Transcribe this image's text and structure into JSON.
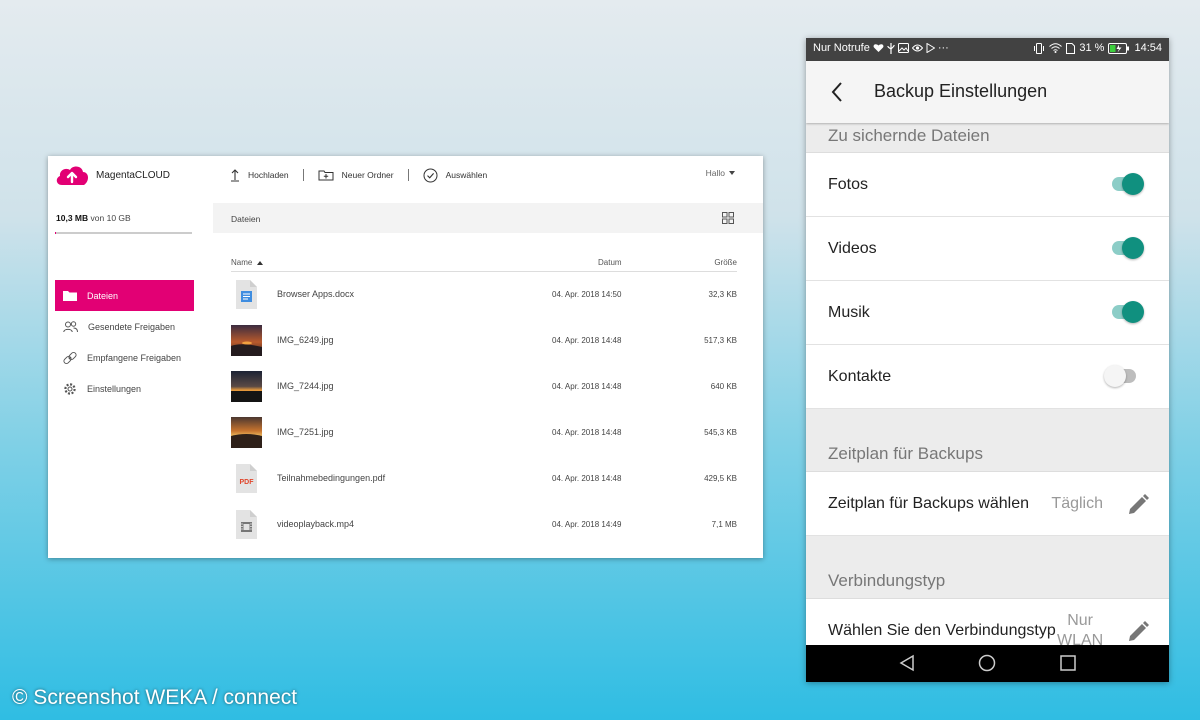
{
  "web": {
    "brand": {
      "prefix": "Magenta",
      "suffix": "CLOUD"
    },
    "toolbar": {
      "upload": "Hochladen",
      "new_folder": "Neuer Ordner",
      "select": "Auswählen"
    },
    "greeting": "Hallo",
    "storage": {
      "used": "10,3 MB",
      "of": "von",
      "total": "10 GB",
      "used_fraction": 0.001
    },
    "breadcrumb": "Dateien",
    "sidebar": [
      {
        "label": "Dateien",
        "icon": "folder-icon",
        "active": true
      },
      {
        "label": "Gesendete Freigaben",
        "icon": "people-icon",
        "active": false
      },
      {
        "label": "Empfangene Freigaben",
        "icon": "link-icon",
        "active": false
      },
      {
        "label": "Einstellungen",
        "icon": "gear-icon",
        "active": false
      }
    ],
    "columns": {
      "name": "Name",
      "date": "Datum",
      "size": "Größe"
    },
    "files": [
      {
        "name": "Browser Apps.docx",
        "date": "04. Apr. 2018 14:50",
        "size": "32,3 KB",
        "icon": "docx-file-icon"
      },
      {
        "name": "IMG_6249.jpg",
        "date": "04. Apr. 2018 14:48",
        "size": "517,3 KB",
        "icon": "image-thumbnail"
      },
      {
        "name": "IMG_7244.jpg",
        "date": "04. Apr. 2018 14:48",
        "size": "640 KB",
        "icon": "image-thumbnail"
      },
      {
        "name": "IMG_7251.jpg",
        "date": "04. Apr. 2018 14:48",
        "size": "545,3 KB",
        "icon": "image-thumbnail"
      },
      {
        "name": "Teilnahmebedingungen.pdf",
        "date": "04. Apr. 2018 14:48",
        "size": "429,5 KB",
        "icon": "pdf-file-icon",
        "icon_text": "PDF"
      },
      {
        "name": "videoplayback.mp4",
        "date": "04. Apr. 2018 14:49",
        "size": "7,1 MB",
        "icon": "video-file-icon"
      }
    ],
    "accent_color": "#e20074"
  },
  "phone": {
    "status": {
      "carrier": "Nur Notrufe",
      "battery": "31 %",
      "time": "14:54"
    },
    "title": "Backup Einstellungen",
    "sections": {
      "files": "Zu sichernde Dateien",
      "schedule": "Zeitplan für Backups",
      "connection": "Verbindungstyp"
    },
    "toggles": [
      {
        "label": "Fotos",
        "on": true
      },
      {
        "label": "Videos",
        "on": true
      },
      {
        "label": "Musik",
        "on": true
      },
      {
        "label": "Kontakte",
        "on": false
      }
    ],
    "schedule_row": {
      "label": "Zeitplan für Backups wählen",
      "value": "Täglich"
    },
    "connection_row": {
      "label": "Wählen Sie den Verbindungstyp",
      "value": "Nur WLAN"
    },
    "switch_color": "#10907f"
  },
  "credit": "© Screenshot WEKA / connect"
}
